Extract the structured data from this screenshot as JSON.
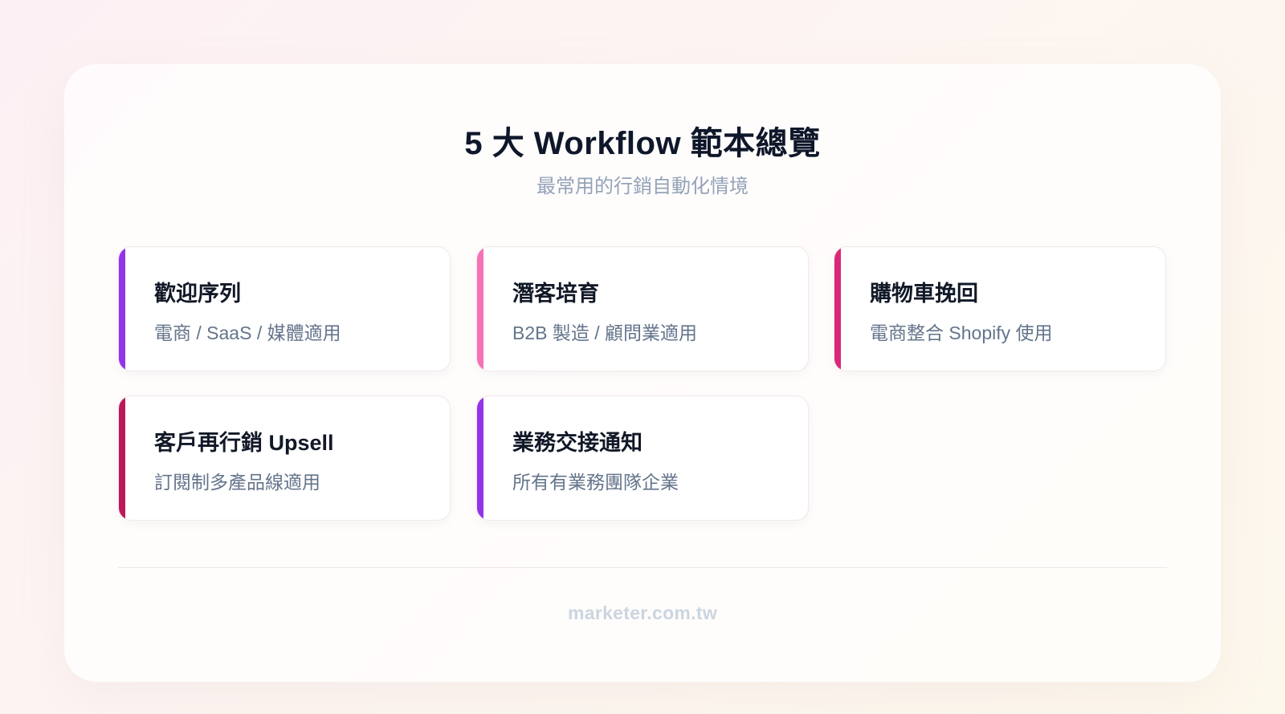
{
  "header": {
    "title": "5 大 Workflow 範本總覽",
    "subtitle": "最常用的行銷自動化情境"
  },
  "cards": [
    {
      "title": "歡迎序列",
      "desc": "電商 / SaaS / 媒體適用",
      "accent": "#9333ea"
    },
    {
      "title": "潛客培育",
      "desc": "B2B 製造 / 顧問業適用",
      "accent": "#f472b6"
    },
    {
      "title": "購物車挽回",
      "desc": "電商整合 Shopify 使用",
      "accent": "#db2777"
    },
    {
      "title": "客戶再行銷 Upsell",
      "desc": "訂閱制多產品線適用",
      "accent": "#be185d"
    },
    {
      "title": "業務交接通知",
      "desc": "所有有業務團隊企業",
      "accent": "#9333ea"
    }
  ],
  "footer": {
    "text": "marketer.com.tw"
  }
}
